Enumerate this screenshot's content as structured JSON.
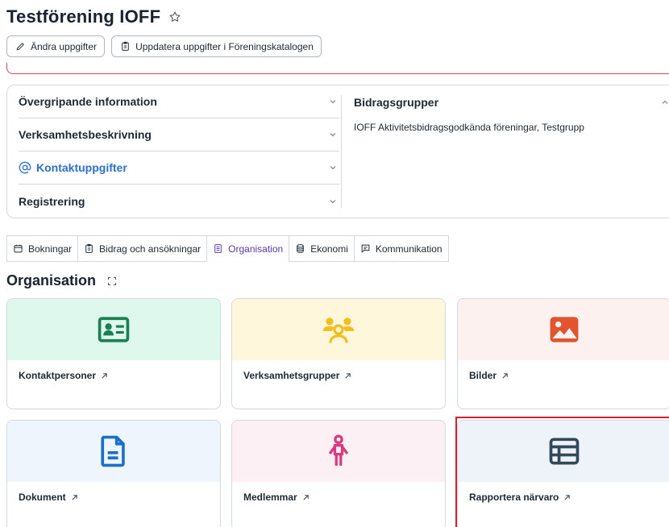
{
  "header": {
    "title": "Testförening IOFF",
    "favorite_icon": "star-icon"
  },
  "actions": {
    "edit_label": "Ändra uppgifter",
    "update_catalog_label": "Uppdatera uppgifter i Föreningskatalogen"
  },
  "accordion": {
    "items": [
      {
        "label": "Övergripande information"
      },
      {
        "label": "Verksamhetsbeskrivning"
      },
      {
        "label": "Kontaktuppgifter",
        "icon": "at-icon"
      },
      {
        "label": "Registrering"
      }
    ]
  },
  "bidragsgrupper": {
    "title": "Bidragsgrupper",
    "text": "IOFF Aktivitetsbidragsgodkända föreningar, Testgrupp"
  },
  "tabs": [
    {
      "label": "Bokningar",
      "icon": "calendar-icon"
    },
    {
      "label": "Bidrag och ansökningar",
      "icon": "clipboard-icon"
    },
    {
      "label": "Organisation",
      "icon": "building-icon",
      "active": true
    },
    {
      "label": "Ekonomi",
      "icon": "coins-icon"
    },
    {
      "label": "Kommunikation",
      "icon": "chat-icon"
    }
  ],
  "section": {
    "title": "Organisation"
  },
  "cards": [
    {
      "label": "Kontaktpersoner",
      "icon": "id-card-icon",
      "bg": "#dff8ee",
      "color": "#1a7f52"
    },
    {
      "label": "Verksamhetsgrupper",
      "icon": "group-icon",
      "bg": "#fff7dc",
      "color": "#f3bd1a"
    },
    {
      "label": "Bilder",
      "icon": "image-icon",
      "bg": "#fdf1ef",
      "color": "#e0542f"
    },
    {
      "label": "Dokument",
      "icon": "document-icon",
      "bg": "#eef5fd",
      "color": "#1c6fc9"
    },
    {
      "label": "Medlemmar",
      "icon": "person-icon",
      "bg": "#fdf0f4",
      "color": "#d83a7c"
    },
    {
      "label": "Rapportera närvaro",
      "icon": "table-icon",
      "bg": "#eef3f9",
      "color": "#34485c"
    }
  ],
  "colors": {
    "accent_purple": "#5b3aa8",
    "link_blue": "#2c6fcf",
    "highlight_red": "#d81f2f"
  }
}
